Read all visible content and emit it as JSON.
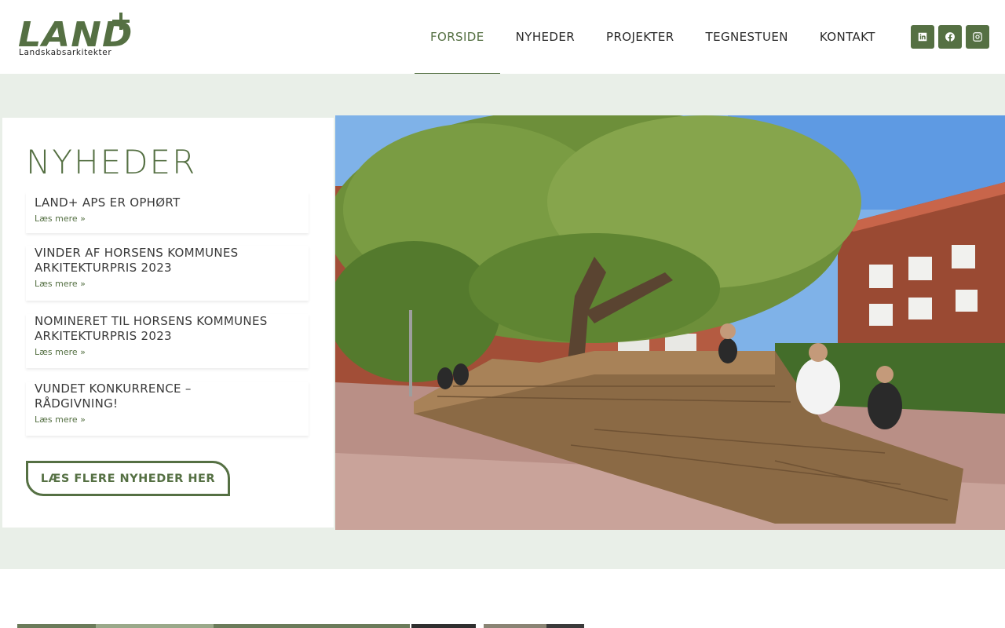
{
  "logo": {
    "word": "LAND",
    "subtitle": "Landskabsarkitekter"
  },
  "nav": {
    "items": [
      {
        "label": "FORSIDE",
        "active": true
      },
      {
        "label": "NYHEDER",
        "active": false
      },
      {
        "label": "PROJEKTER",
        "active": false
      },
      {
        "label": "TEGNESTUEN",
        "active": false
      },
      {
        "label": "KONTAKT",
        "active": false
      }
    ]
  },
  "social": [
    "linkedin-icon",
    "facebook-icon",
    "instagram-icon"
  ],
  "news": {
    "heading": "NYHEDER",
    "items": [
      {
        "title": "LAND+ APS ER OPHØRT",
        "more": "Læs mere »"
      },
      {
        "title": "VINDER AF HORSENS KOMMUNES ARKITEKTURPRIS 2023",
        "more": "Læs mere »"
      },
      {
        "title": "NOMINERET TIL HORSENS KOMMUNES ARKITEKTURPRIS 2023",
        "more": "Læs mere »"
      },
      {
        "title": "VUNDET KONKURRENCE – RÅDGIVNING!",
        "more": "Læs mere »"
      }
    ],
    "button_label": "LÆS FLERE NYHEDER HER"
  },
  "colors": {
    "accent": "#557043",
    "hero_bg": "#e9efe8"
  }
}
